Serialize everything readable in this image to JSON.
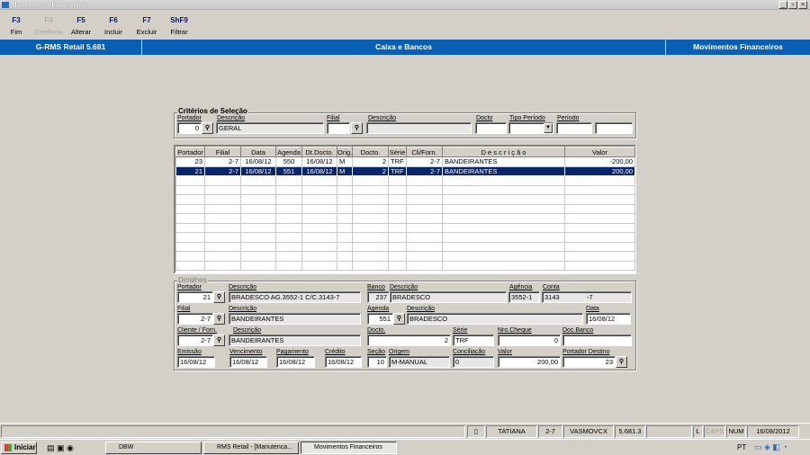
{
  "window": {
    "title": "Movimentos Financeiros"
  },
  "toolbar": [
    {
      "key": "F3",
      "label": "Fim",
      "enabled": true
    },
    {
      "key": "F4",
      "label": "Confirma",
      "enabled": false
    },
    {
      "key": "F5",
      "label": "Alterar",
      "enabled": true
    },
    {
      "key": "F6",
      "label": "Incluir",
      "enabled": true
    },
    {
      "key": "F7",
      "label": "Excluir",
      "enabled": true
    },
    {
      "key": "ShF9",
      "label": "Filtrar",
      "enabled": true
    }
  ],
  "header": {
    "app": "G-RMS Retail 5.681",
    "module": "Caixa e Bancos",
    "screen": "Movimentos Financeiros",
    "color": "#0a5fb4"
  },
  "criteria": {
    "title": "Critérios de Seleção",
    "portador_label": "Portador",
    "portador": "0",
    "descricao_label": "Descrição",
    "descricao": "GERAL",
    "filial_label": "Filial",
    "filial": "",
    "descricao2_label": "Descrição",
    "descricao2": "",
    "docto_label": "Docto",
    "docto": "",
    "tipo_label": "Tipo Período",
    "tipo": "",
    "periodo_label": "Período",
    "periodo_de": "",
    "periodo_ate": ""
  },
  "grid": {
    "columns": [
      "Portador",
      "Filial",
      "Data",
      "Agenda",
      "Dt.Docto.",
      "Orig.",
      "Docto.",
      "Série",
      "Cli/Forn.",
      "D e s c r i ç ã o",
      "Valor"
    ],
    "rows": [
      [
        "23",
        "2-7",
        "16/08/12",
        "550",
        "16/08/12",
        "M",
        "2",
        "TRF",
        "2-7",
        "BANDEIRANTES",
        "-200,00"
      ],
      [
        "21",
        "2-7",
        "16/08/12",
        "551",
        "16/08/12",
        "M",
        "2",
        "TRF",
        "2-7",
        "BANDEIRANTES",
        "200,00"
      ]
    ],
    "selected_row": 1
  },
  "details": {
    "title": "Detalhes",
    "portador_label": "Portador",
    "portador": "21",
    "portador_desc_label": "Descrição",
    "portador_desc": "BRADESCO AG.3552-1 C/C.3143-7",
    "banco_label": "Banco",
    "banco": "237",
    "banco_desc_label": "Descrição",
    "banco_desc": "BRADESCO",
    "agencia_label": "Agência",
    "agencia": "3552-1",
    "conta_label": "Conta",
    "conta": "3143",
    "conta_dv": "-7",
    "filial_label": "Filial",
    "filial": "2-7",
    "filial_desc_label": "Descrição",
    "filial_desc": "BANDEIRANTES",
    "agenda_label": "Agenda",
    "agenda": "551",
    "agenda_desc_label": "Descrição",
    "agenda_desc": "BRADESCO",
    "data_label": "Data",
    "data": "16/08/12",
    "cliente_label": "Cliente / Forn.",
    "cliente": "2-7",
    "cliente_desc_label": "Descrição",
    "cliente_desc": "BANDEIRANTES",
    "docto_label": "Docto.",
    "docto": "2",
    "serie_label": "Série",
    "serie": "TRF",
    "cheque_label": "Nro.Cheque",
    "cheque": "0",
    "docbanco_label": "Doc.Banco",
    "docbanco": "",
    "emissao_label": "Emissão",
    "emissao": "16/08/12",
    "vencimento_label": "Vencimento",
    "vencimento": "16/08/12",
    "pagamento_label": "Pagamento",
    "pagamento": "16/08/12",
    "credito_label": "Crédito",
    "credito": "16/08/12",
    "secao_label": "Seção",
    "secao": "10",
    "origem_label": "Origem",
    "origem": "M-MANUAL",
    "conciliacao_label": "Conciliação",
    "conciliacao": "0",
    "valor_label": "Valor",
    "valor": "200,00",
    "destino_label": "Portador Destino",
    "destino": "23"
  },
  "status": {
    "user": "TATIANA",
    "filial": "2-7",
    "program": "VASMOVCX",
    "version": "5.681.3",
    "l": "L",
    "caps": "CAPS",
    "num": "NUM",
    "date": "16/08/2012"
  },
  "taskbar": {
    "start": "Iniciar",
    "tasks": [
      "DBW",
      "RMS Retail - [Manutenca...",
      "Movimentos Financeiros"
    ],
    "lang": "PT"
  }
}
